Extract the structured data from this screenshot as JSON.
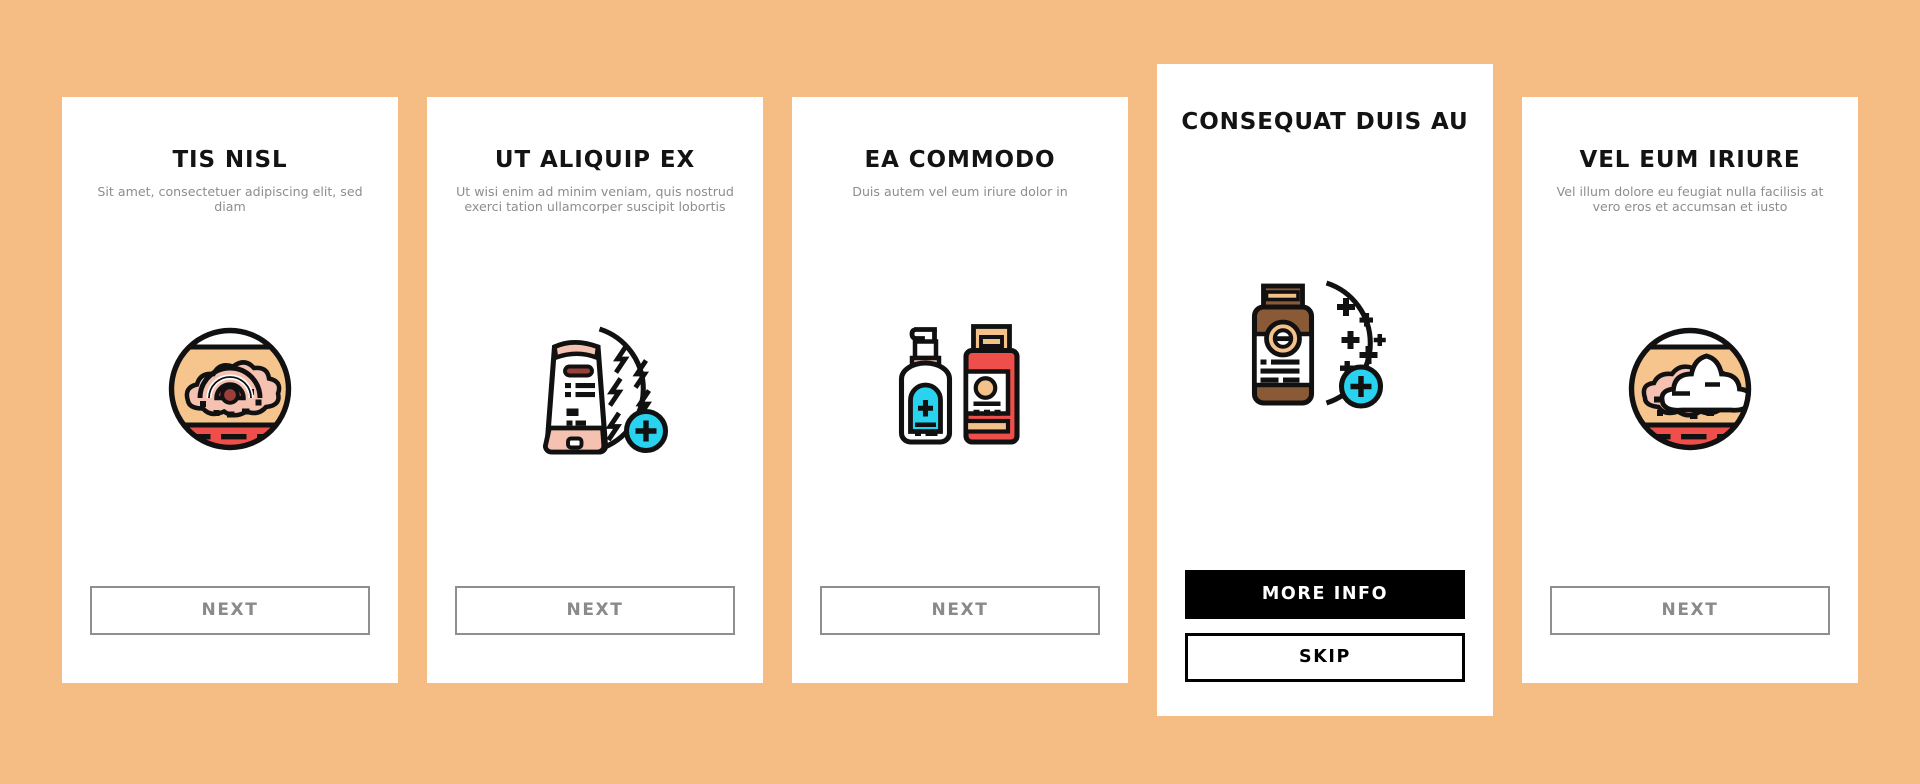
{
  "background_color": "#f5bd83",
  "palette": {
    "ink": "#131313",
    "subtitle": "#8d8d8d",
    "cyan": "#29d3f0",
    "red": "#ef4f4a",
    "skin": "#f6c48d",
    "skin_light": "#f5c2b1",
    "brown": "#8a5a36",
    "tan": "#f3c189",
    "button_border": "#8f8f8f",
    "button_text": "#8a8a8a"
  },
  "cards": [
    {
      "id": "tis-nisl",
      "title": "TIS NISL",
      "subtitle": "Sit amet, consectetuer adipiscing elit, sed diam",
      "icon": "skin-rash-circle-icon",
      "buttons": [
        {
          "label": "NEXT",
          "style": "next",
          "name": "next-button"
        }
      ]
    },
    {
      "id": "ut-aliquip-ex",
      "title": "UT ALIQUIP EX",
      "subtitle": "Ut wisi enim ad minim veniam, quis nostrud exerci tation ullamcorper suscipit lobortis",
      "icon": "cream-tube-lightning-icon",
      "buttons": [
        {
          "label": "NEXT",
          "style": "next",
          "name": "next-button"
        }
      ]
    },
    {
      "id": "ea-commodo",
      "title": "EA COMMODO",
      "subtitle": "Duis autem vel eum iriure dolor in",
      "icon": "lotion-bottles-icon",
      "buttons": [
        {
          "label": "NEXT",
          "style": "next",
          "name": "next-button"
        }
      ]
    },
    {
      "id": "consequat-duis-au",
      "title": "CONSEQUAT DUIS AU",
      "subtitle": "",
      "icon": "medicine-bottle-sparkle-icon",
      "featured": true,
      "buttons": [
        {
          "label": "MORE INFO",
          "style": "primary",
          "name": "more-info-button"
        },
        {
          "label": "SKIP",
          "style": "secondary",
          "name": "skip-button"
        }
      ]
    },
    {
      "id": "vel-eum-iriure",
      "title": "VEL EUM IRIURE",
      "subtitle": "Vel illum dolore eu feugiat nulla facilisis at vero eros et accumsan et iusto",
      "icon": "skin-cream-applied-icon",
      "buttons": [
        {
          "label": "NEXT",
          "style": "next",
          "name": "next-button"
        }
      ]
    }
  ]
}
